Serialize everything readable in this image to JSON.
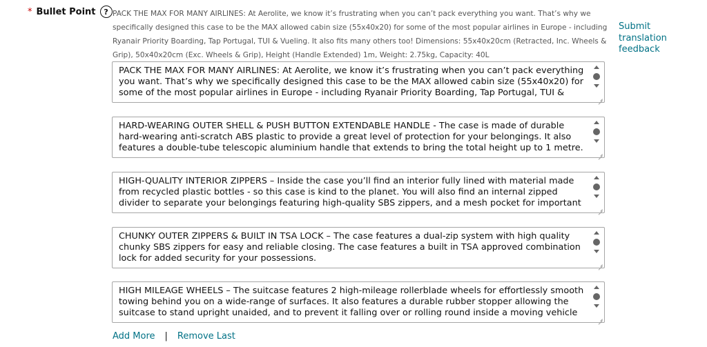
{
  "field": {
    "required_mark": "*",
    "label": "Bullet Point",
    "help_icon_glyph": "?",
    "source_text": "PACK THE MAX FOR MANY AIRLINES: At Aerolite, we know it’s frustrating when you can’t pack everything you want. That’s why we specifically designed this case to be the MAX allowed cabin size (55x40x20) for some of the most popular airlines in Europe - including Ryanair Priority Boarding, Tap Portugal, TUI & Vueling. It also fits many others too! Dimensions: 55x40x20cm (Retracted, Inc. Wheels & Grip), 50x40x20cm (Exc. Wheels & Grip), Height (Handle Extended) 1m, Weight: 2.75kg, Capacity: 40L",
    "feedback_link": "Submit translation feedback"
  },
  "bullets": [
    "PACK THE MAX FOR MANY AIRLINES: At Aerolite, we know it’s frustrating when you can’t pack everything you want. That’s why we specifically designed this case to be the MAX allowed cabin size (55x40x20) for some of the most popular airlines in Europe - including Ryanair Priority Boarding, Tap Portugal, TUI & Vueling. It also fits many others too! Dimensions: 55x40x20cm (Retracted, Inc. Wheels & Grip)",
    "HARD-WEARING OUTER SHELL & PUSH BUTTON EXTENDABLE HANDLE - The case is made of durable hard-wearing anti-scratch ABS plastic to provide a great level of protection for your belongings. It also features a double-tube telescopic aluminium handle that extends to bring the total height up to 1 metre. The handle is retracted using the push button when not required.",
    "HIGH-QUALITY INTERIOR ZIPPERS – Inside the case you’ll find an interior fully lined with material made from recycled plastic bottles - so this case is kind to the planet. You will also find an internal zipped divider to separate your belongings featuring high-quality SBS zippers, and a mesh pocket for important documents.",
    "CHUNKY OUTER ZIPPERS & BUILT IN TSA LOCK – The case features a dual-zip system with high quality chunky SBS zippers for easy and reliable closing. The case features a built in TSA approved combination lock for added security for your possessions.",
    "HIGH MILEAGE WHEELS – The suitcase features 2 high-mileage rollerblade wheels for effortlessly smooth towing behind you on a wide-range of surfaces. It also features a durable rubber stopper allowing the suitcase to stand upright unaided, and to prevent it falling over or rolling round inside a moving vehicle such as a train."
  ],
  "actions": {
    "add_more": "Add More",
    "separator": "|",
    "remove_last": "Remove Last"
  }
}
